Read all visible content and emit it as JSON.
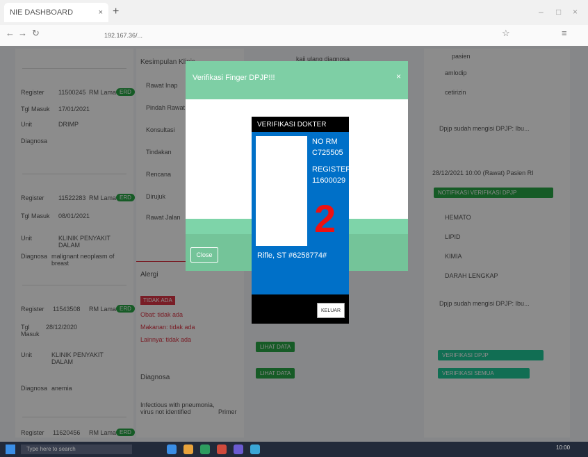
{
  "browser": {
    "tab_title": "NIE DASHBOARD",
    "tab_close": "×",
    "new_tab": "+",
    "url": "192.167.36/...",
    "min": "–",
    "max": "□",
    "close": "×"
  },
  "patients": [
    {
      "reg_label": "Register",
      "reg": "11500245",
      "rm_label": "RM Lama",
      "badge": "ERD",
      "tgl_label": "Tgl Masuk",
      "tgl": "17/01/2021",
      "unit_label": "Unit",
      "unit": "DRIMP",
      "diag_label": "Diagnosa",
      "diag": ""
    },
    {
      "reg_label": "Register",
      "reg": "11522283",
      "rm_label": "RM Lama",
      "badge": "ERD",
      "tgl_label": "Tgl Masuk",
      "tgl": "08/01/2021",
      "unit_label": "Unit",
      "unit": "KLINIK PENYAKIT DALAM",
      "diag_label": "Diagnosa",
      "diag": "malignant neoplasm of breast"
    },
    {
      "reg_label": "Register",
      "reg": "11543508",
      "rm_label": "RM Lama",
      "badge": "ERD",
      "tgl_label": "Tgl Masuk",
      "tgl": "28/12/2020",
      "unit_label": "Unit",
      "unit": "KLINIK PENYAKIT DALAM",
      "diag_label": "Diagnosa",
      "diag": "anemia"
    },
    {
      "reg_label": "Register",
      "reg": "11620456",
      "rm_label": "RM Lama",
      "badge": "ERD"
    }
  ],
  "kesimpulan": {
    "title": "Kesimpulan Klinis",
    "items": [
      "Rawat Inap",
      "Pindah Rawat",
      "Konsultasi",
      "Tindakan",
      "Rencana",
      "Dirujuk",
      "Rawat Jalan"
    ]
  },
  "alergi": {
    "title": "Alergi",
    "badge": "TIDAK ADA",
    "lines": [
      "Obat: tidak ada",
      "Makanan: tidak ada",
      "Lainnya: tidak ada"
    ]
  },
  "diagnosa": {
    "title": "Diagnosa",
    "text": "Infectious with pneumonia, virus not identified",
    "status": "Primer"
  },
  "col3": {
    "top": "kaji ulang diagnosa",
    "btn1": "LIHAT DATA",
    "btn2": "LIHAT DATA"
  },
  "timeline": {
    "item1": "pasien",
    "list1": [
      "amlodip",
      "cetirizin"
    ],
    "note1": "Dpjp sudah mengisi DPJP: Ibu...",
    "date": "28/12/2021 10:00 (Rawat) Pasien RI",
    "banner": "NOTIFIKASI VERIFIKASI DPJP",
    "list2": [
      "HEMATO",
      "LIPID",
      "KIMIA",
      "DARAH LENGKAP"
    ],
    "note2": "Dpjp sudah mengisi DPJP: Ibu...",
    "btn_a": "VERIFIKASI DPJP",
    "btn_b": "VERIFIKASI SEMUA"
  },
  "modal_finger": {
    "title": "Verifikasi Finger DPJP!!!",
    "close_icon": "×",
    "close_label": "Close"
  },
  "verifikasi": {
    "header": "VERIFIKASI DOKTER",
    "norm_label": "NO RM",
    "norm": "C725505",
    "register_label": "REGISTER",
    "register": "11600029",
    "number": "2",
    "doctor": "Rifle, ST #6258774#",
    "keluar": "KELUAR"
  },
  "taskbar": {
    "search": "Type here to search",
    "clock": "10:00"
  }
}
